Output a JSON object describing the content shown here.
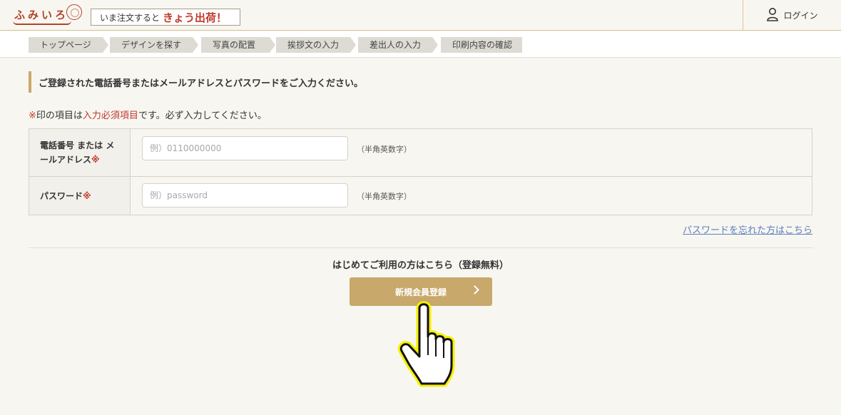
{
  "header": {
    "logo_text": "ふみいろ",
    "banner_small": "いま注文すると",
    "banner_big": "きょう出荷！",
    "login_label": "ログイン",
    "user_icon": "user-icon"
  },
  "steps": [
    {
      "label": "トップページ"
    },
    {
      "label": "デザインを探す"
    },
    {
      "label": "写真の配置"
    },
    {
      "label": "挨拶文の入力"
    },
    {
      "label": "差出人の入力"
    },
    {
      "label": "印刷内容の確認"
    }
  ],
  "main": {
    "heading": "ご登録された電話番号またはメールアドレスとパスワードをご入力ください。",
    "note_mark": "※",
    "note_pre": "印の項目は",
    "note_required": "入力必須項目",
    "note_post": "です。必ず入力してください。",
    "required_mark": "※",
    "phone_label_line1": "電話番号 または メ",
    "phone_label_line2": "ールアドレス",
    "phone_placeholder": "例）0110000000",
    "phone_hint": "（半角英数字）",
    "password_label": "パスワード",
    "password_placeholder": "例）password",
    "password_hint": "（半角英数字）",
    "forgot_link": "パスワードを忘れた方はこちら",
    "first_time_text": "はじめてご利用の方はこちら（登録無料）",
    "register_button": "新規会員登録"
  },
  "colors": {
    "accent": "#c8a86b",
    "required": "#c0392b",
    "link": "#5a7fbf",
    "background": "#f8f6f0"
  }
}
